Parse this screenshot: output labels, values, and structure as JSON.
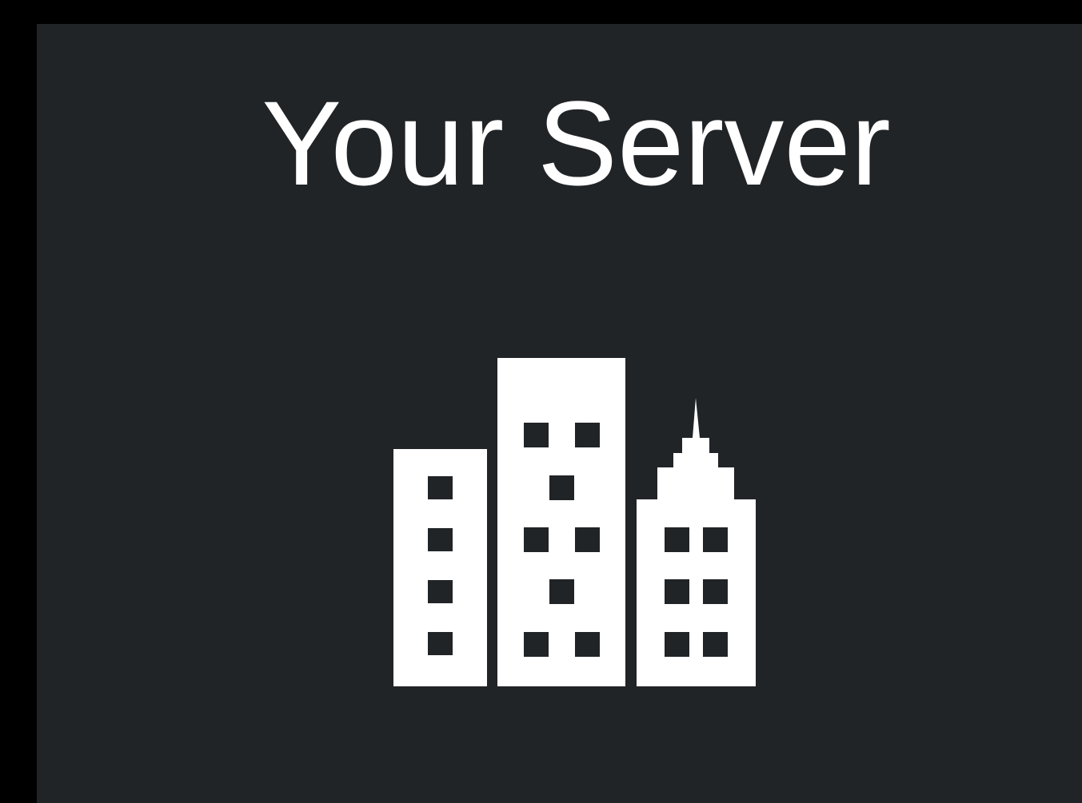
{
  "title": "Your Server",
  "icon": "city-buildings-icon",
  "colors": {
    "background": "#000000",
    "panel": "#212427",
    "foreground": "#ffffff"
  }
}
